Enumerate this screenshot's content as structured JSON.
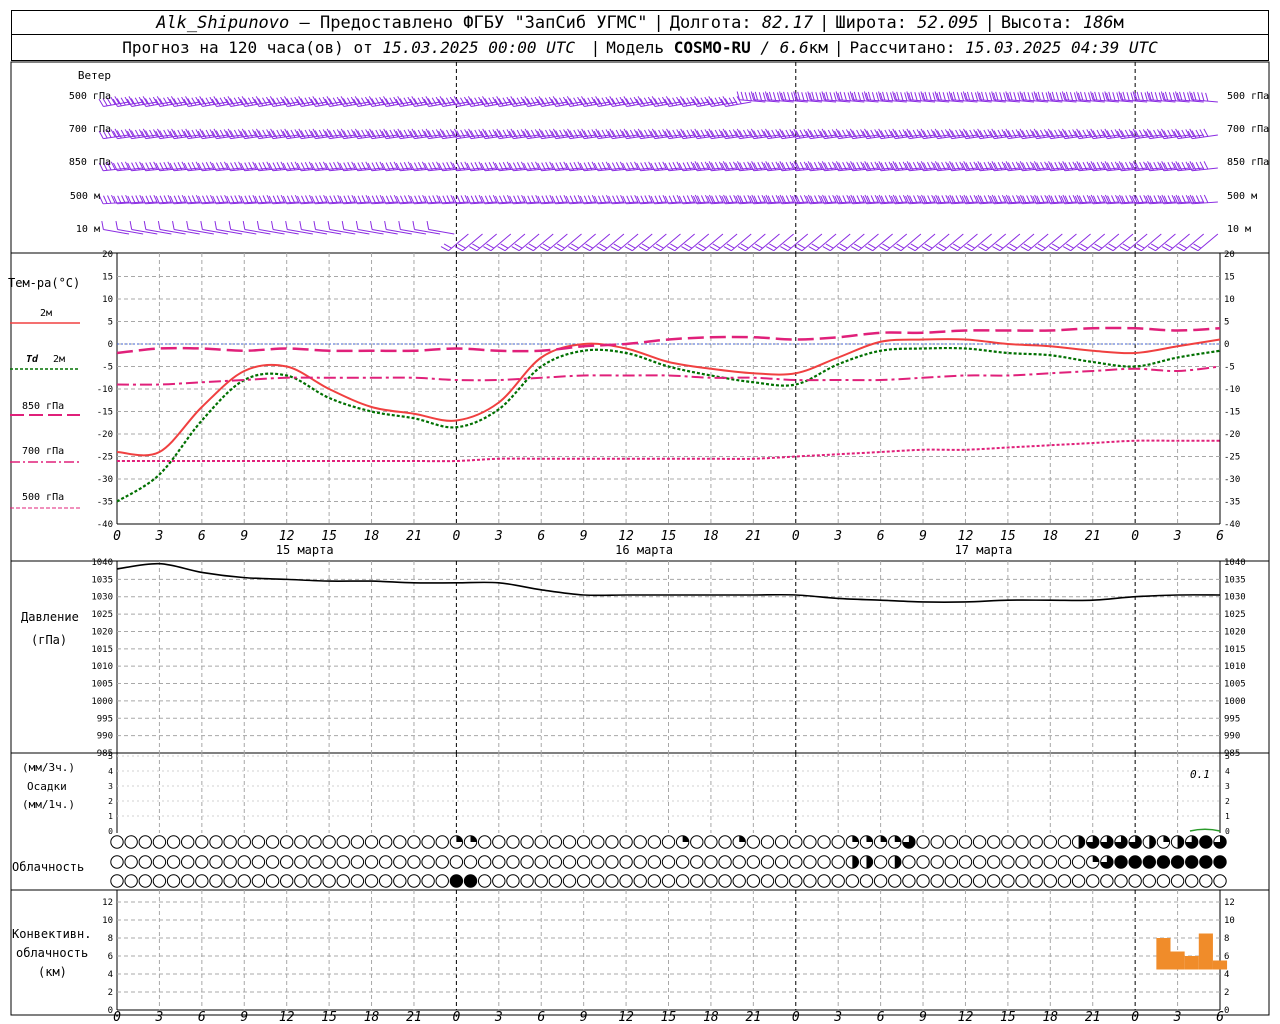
{
  "header": {
    "station": "Alk_Shipunovo",
    "provider": "– Предоставлено ФГБУ \"ЗапСиб УГМС\"",
    "lon_label": "Долгота:",
    "lon_value": "82.17",
    "lat_label": "Широта:",
    "lat_value": "52.095",
    "alt_label": "Высота:",
    "alt_value": "186",
    "alt_unit": "м",
    "forecast_label": "Прогноз на 120 часа(ов) от",
    "forecast_start": "15.03.2025 00:00 UTC",
    "model_label": "Модель",
    "model_name": "COSMO-RU",
    "model_res": "/ 6.6",
    "model_res_unit": "км",
    "calc_label": "Рассчитано:",
    "calc_time": "15.03.2025 04:39 UTC"
  },
  "labels": {
    "wind": "Ветер",
    "wind_levels": [
      "500 гПа",
      "700 гПа",
      "850 гПа",
      "500 м",
      "10  м"
    ],
    "temp_title": "Тем-ра(°С)",
    "t2m": "2м",
    "td_prefix": "Td",
    "td_suffix": "2м",
    "t850": "850 гПа",
    "t700": "700 гПа",
    "t500": "500 гПа",
    "pressure_1": "Давление",
    "pressure_2": "(гПа)",
    "precip_1": "(мм/3ч.)",
    "precip_2": "Осадки",
    "precip_3": "(мм/1ч.)",
    "precip_value": "0.1",
    "cloud": "Облачность",
    "conv_1": "Конвективн.",
    "conv_2": "облачность",
    "conv_3": "(км)"
  },
  "colors": {
    "wind": "#8a2be2",
    "t2m": "#f04040",
    "td": "#007000",
    "t850": "#e0207a",
    "grid": "#a8a8a8",
    "conv": "#f08c2a"
  },
  "chart_data": [
    {
      "type": "line",
      "title": "Тем-ра(°С)",
      "x_hours": [
        0,
        3,
        6,
        9,
        12,
        15,
        18,
        21,
        24,
        27,
        30,
        33,
        36,
        39,
        42,
        45,
        48,
        51,
        54,
        57,
        60,
        63,
        66,
        69,
        72,
        75,
        78
      ],
      "x_ticks": [
        "0",
        "3",
        "6",
        "9",
        "12",
        "15",
        "18",
        "21",
        "0",
        "3",
        "6",
        "9",
        "12",
        "15",
        "18",
        "21",
        "0",
        "3",
        "6",
        "9",
        "12",
        "15",
        "18",
        "21",
        "0",
        "3",
        "6"
      ],
      "dates": [
        "15 марта",
        "16 марта",
        "17 марта"
      ],
      "ylim": [
        -40,
        20
      ],
      "yticks": [
        20,
        15,
        10,
        5,
        0,
        -5,
        -10,
        -15,
        -20,
        -25,
        -30,
        -35,
        -40
      ],
      "series": [
        {
          "name": "2м",
          "values": [
            -24,
            -24,
            -14,
            -6,
            -5,
            -10,
            -14,
            -15.5,
            -17,
            -13,
            -3,
            0,
            -1,
            -4,
            -5.5,
            -6.5,
            -6.5,
            -3,
            0.5,
            1,
            1,
            0,
            -0.5,
            -1.5,
            -2,
            -0.5,
            1
          ]
        },
        {
          "name": "Td 2м",
          "values": [
            -35,
            -29,
            -17,
            -8,
            -7,
            -12,
            -15,
            -16.5,
            -18.5,
            -14.5,
            -5,
            -1.5,
            -2,
            -5,
            -7,
            -8.5,
            -9,
            -4.5,
            -1.5,
            -1,
            -1,
            -2,
            -2.5,
            -4,
            -5,
            -3,
            -1.5
          ]
        },
        {
          "name": "850 гПа",
          "values": [
            -2,
            -1,
            -1,
            -1.5,
            -1,
            -1.5,
            -1.5,
            -1.5,
            -1,
            -1.5,
            -1.5,
            -0.5,
            0,
            1,
            1.5,
            1.5,
            1,
            1.5,
            2.5,
            2.5,
            3,
            3,
            3,
            3.5,
            3.5,
            3,
            3.5
          ]
        },
        {
          "name": "700 гПа",
          "values": [
            -9,
            -9,
            -8.5,
            -8,
            -7.5,
            -7.5,
            -7.5,
            -7.5,
            -8,
            -8,
            -7.5,
            -7,
            -7,
            -7,
            -7.5,
            -7.5,
            -8,
            -8,
            -8,
            -7.5,
            -7,
            -7,
            -6.5,
            -6,
            -5.5,
            -6,
            -5
          ]
        },
        {
          "name": "500 гПа",
          "values": [
            -26,
            -26,
            -26,
            -26,
            -26,
            -26,
            -26,
            -26,
            -26,
            -25.5,
            -25.5,
            -25.5,
            -25.5,
            -25.5,
            -25.5,
            -25.5,
            -25,
            -24.5,
            -24,
            -23.5,
            -23.5,
            -23,
            -22.5,
            -22,
            -21.5,
            -21.5,
            -21.5
          ]
        }
      ]
    },
    {
      "type": "line",
      "title": "Давление (гПа)",
      "x_hours": [
        0,
        3,
        6,
        9,
        12,
        15,
        18,
        21,
        24,
        27,
        30,
        33,
        36,
        39,
        42,
        45,
        48,
        51,
        54,
        57,
        60,
        63,
        66,
        69,
        72,
        75,
        78
      ],
      "ylim": [
        985,
        1040
      ],
      "yticks": [
        1040,
        1035,
        1030,
        1025,
        1020,
        1015,
        1010,
        1005,
        1000,
        995,
        990,
        985
      ],
      "series": [
        {
          "name": "Давление",
          "values": [
            1038,
            1039.5,
            1037,
            1035.5,
            1035,
            1034.5,
            1034.5,
            1034,
            1034,
            1034,
            1032,
            1030.5,
            1030.5,
            1030.5,
            1030.5,
            1030.5,
            1030.5,
            1029.5,
            1029,
            1028.5,
            1028.5,
            1029,
            1029,
            1029,
            1030,
            1030.5,
            1030.5
          ]
        }
      ]
    },
    {
      "type": "bar",
      "title": "Осадки (мм/3ч.) (мм/1ч.)",
      "ylim": [
        0,
        5
      ],
      "yticks": [
        5,
        4,
        3,
        2,
        1,
        0
      ],
      "annotation": "0.1",
      "series": [
        {
          "name": "Осадки",
          "x_hours": [
            78
          ],
          "values": [
            0.1
          ]
        }
      ]
    },
    {
      "type": "bar",
      "title": "Конвективн. облачность (км)",
      "ylim": [
        0,
        13
      ],
      "yticks": [
        12,
        10,
        8,
        6,
        4,
        2,
        0
      ],
      "series": [
        {
          "name": "Конвективн. облачность",
          "x_hours": [
            74,
            75,
            76,
            77,
            78
          ],
          "bottoms": [
            4.5,
            4.5,
            4.5,
            4.5,
            4.5
          ],
          "tops": [
            8,
            6.5,
            6,
            8.5,
            5.5
          ]
        }
      ]
    }
  ]
}
